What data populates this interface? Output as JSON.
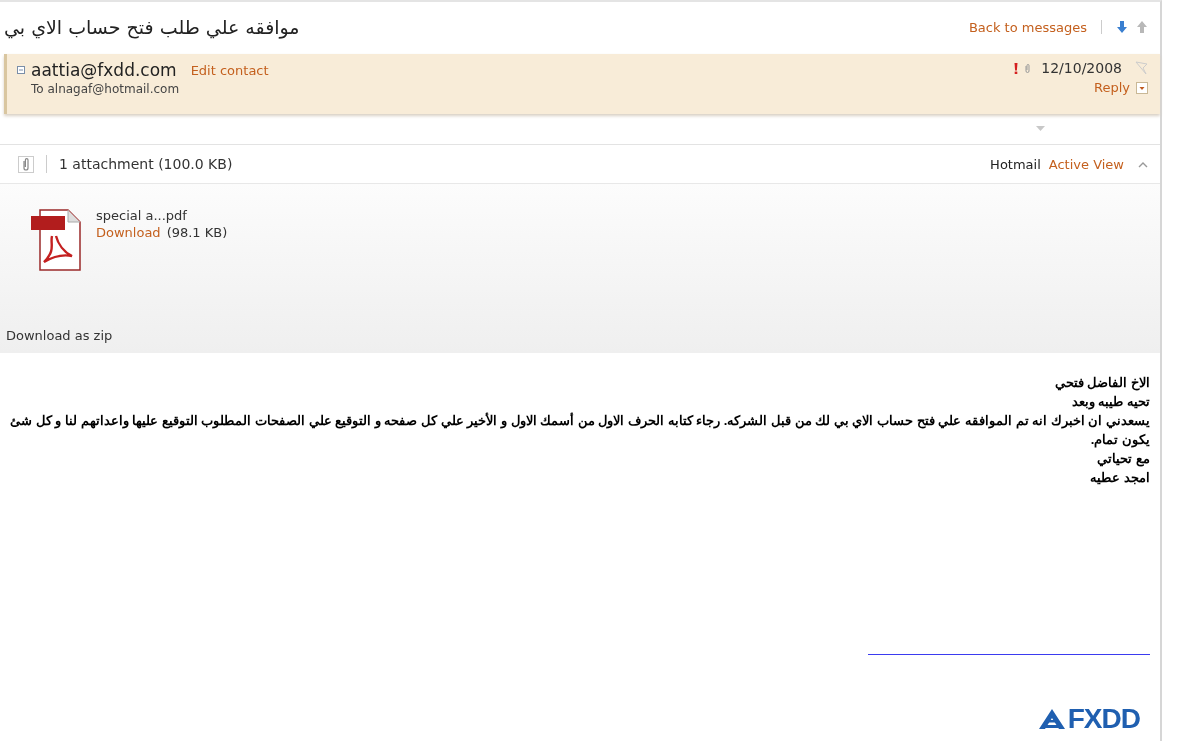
{
  "subject": "موافقه علي طلب فتح حساب الاي بي",
  "nav": {
    "back_link": "Back to messages"
  },
  "header": {
    "sender": "aattia@fxdd.com",
    "edit_link": "Edit contact",
    "recipient": "To alnagaf@hotmail.com",
    "important": true,
    "has_attachment": true,
    "date": "12/10/2008",
    "flagged": false,
    "reply": "Reply",
    "expanded": true
  },
  "attachments": {
    "summary": "1 attachment (100.0 KB)",
    "brand": "Hotmail",
    "view_link": "Active View",
    "files": [
      {
        "name": "special a...pdf",
        "download": "Download",
        "size": "(98.1 KB)"
      }
    ],
    "zip_link": "Download as zip"
  },
  "body": {
    "lines": [
      "الاخ الفاضل فتحي",
      "تحيه طيبه وبعد",
      "يسعدني ان اخبرك انه تم الموافقه علي فتح حساب الاي بي لك من قبل الشركه. رجاء كتابه  الحرف الاول من أسمك الاول و الأخير علي كل صفحه و التوقيع علي الصفحات المطلوب التوقيع عليها واعداتهم لنا و كل شئ يكون تمام.",
      "مع تحياتي",
      "امجد عطيه"
    ],
    "logo": "FXDD"
  }
}
